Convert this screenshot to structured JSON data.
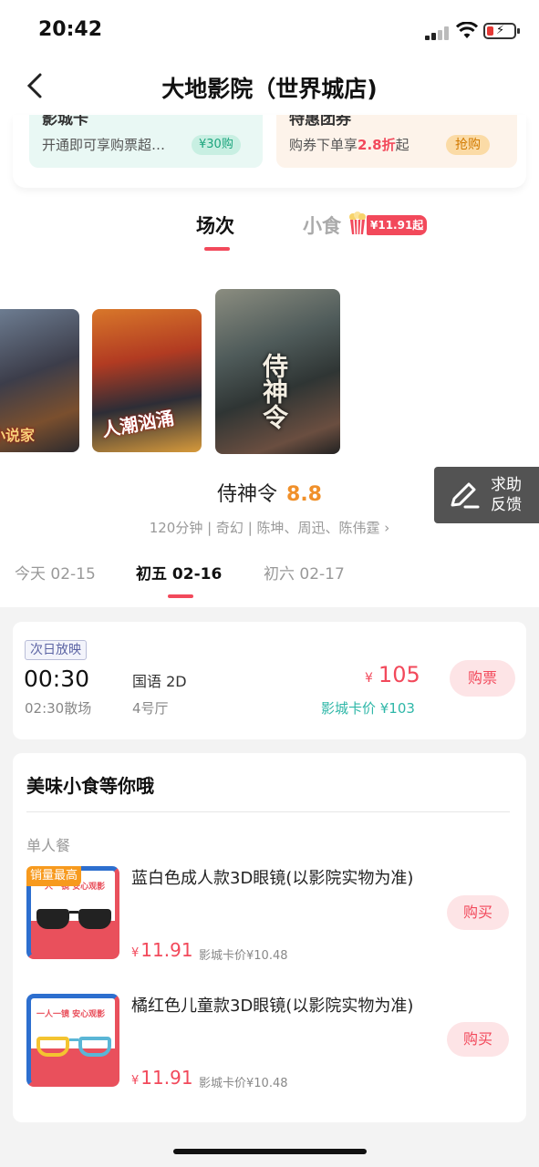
{
  "status_bar": {
    "time": "20:42"
  },
  "nav": {
    "title": "大地影院（世界城店)"
  },
  "promos": [
    {
      "head": "影城卡",
      "sub": "开通即可享购票超…",
      "tag": "¥30购"
    },
    {
      "head": "特惠团券",
      "sub_prefix": "购券下单享",
      "sub_highlight": "2.8折",
      "sub_suffix": "起",
      "tag": "抢购"
    }
  ],
  "tabs": {
    "showtimes": "场次",
    "snacks": "小食",
    "snack_badge": "¥11.91起"
  },
  "posters": [
    {
      "title": "小说家"
    },
    {
      "title": "人潮汹涌"
    },
    {
      "title": "侍神令"
    }
  ],
  "feedback": {
    "label": "求助反馈"
  },
  "movie": {
    "title": "侍神令",
    "score": "8.8",
    "meta": "120分钟 | 奇幻 | 陈坤、周迅、陈伟霆 ›"
  },
  "dates": [
    "今天 02-15",
    "初五 02-16",
    "初六 02-17"
  ],
  "showtime": {
    "badge": "次日放映",
    "start": "00:30",
    "end": "02:30散场",
    "lang": "国语 2D",
    "hall": "4号厅",
    "currency": "¥",
    "price": "105",
    "card_price": "影城卡价 ¥103",
    "buy_label": "购票"
  },
  "snacks": {
    "heading": "美味小食等你哦",
    "category": "单人餐",
    "items": [
      {
        "badge": "销量最高",
        "slogan": "一人一镜 安心观影",
        "name": "蓝白色成人款3D眼镜(以影院实物为准)",
        "currency": "¥",
        "price": "11.91",
        "card_price": "影城卡价¥10.48",
        "buy_label": "购买",
        "color": "#222222"
      },
      {
        "slogan": "一人一镜 安心观影",
        "name": "橘红色儿童款3D眼镜(以影院实物为准)",
        "currency": "¥",
        "price": "11.91",
        "card_price": "影城卡价¥10.48",
        "buy_label": "购买",
        "color": "#f4c430"
      }
    ]
  },
  "colors": {
    "accent": "#f2495b",
    "teal": "#2fb7a8",
    "score": "#f0902a"
  }
}
